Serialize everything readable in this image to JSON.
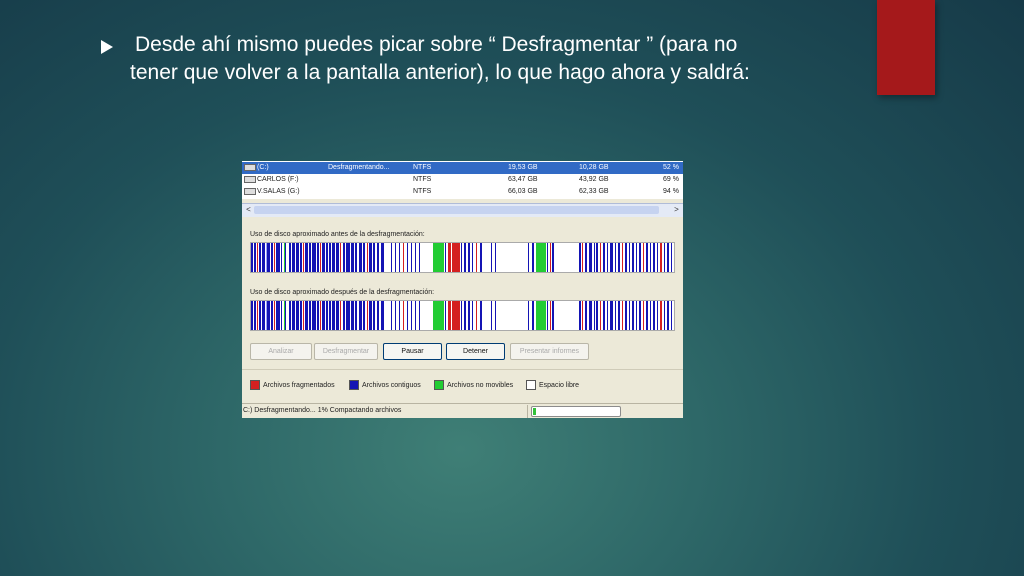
{
  "slide": {
    "line1": "Desde ahí mismo puedes picar sobre “ Desfragmentar ” (para no",
    "line2": "tener que volver a la pantalla anterior), lo que hago ahora y saldrá:",
    "accent_color": "#a5191b"
  },
  "volumes": [
    {
      "name": "(C:)",
      "status": "Desfragmentando...",
      "fs": "NTFS",
      "capacity": "19,53 GB",
      "free": "10,28 GB",
      "pct": "52 %",
      "selected": true
    },
    {
      "name": "CARLOS (F:)",
      "status": "",
      "fs": "NTFS",
      "capacity": "63,47 GB",
      "free": "43,92 GB",
      "pct": "69 %",
      "selected": false
    },
    {
      "name": "V.SALAS (G:)",
      "status": "",
      "fs": "NTFS",
      "capacity": "66,03 GB",
      "free": "62,33 GB",
      "pct": "94 %",
      "selected": false
    }
  ],
  "scroll": {
    "left": "<",
    "right": ">"
  },
  "before_label": "Uso de disco aproximado antes de la desfragmentación:",
  "after_label": "Uso de disco aproximado después de la desfragmentación:",
  "buttons": {
    "analyze": "Analizar",
    "defrag": "Desfragmentar",
    "pause": "Pausar",
    "stop": "Detener",
    "report": "Presentar informes"
  },
  "legend": {
    "fragmented": "Archivos fragmentados",
    "contiguous": "Archivos contiguos",
    "unmovable": "Archivos no movibles",
    "free": "Espacio libre"
  },
  "colors": {
    "fragmented": "#d42020",
    "contiguous": "#1414b4",
    "unmovable": "#22cc33",
    "free": "#ffffff",
    "selection": "#316ac5"
  },
  "status": {
    "text": "C:) Desfragmentando... 1%  Compactando archivos",
    "progress": 0.03
  }
}
